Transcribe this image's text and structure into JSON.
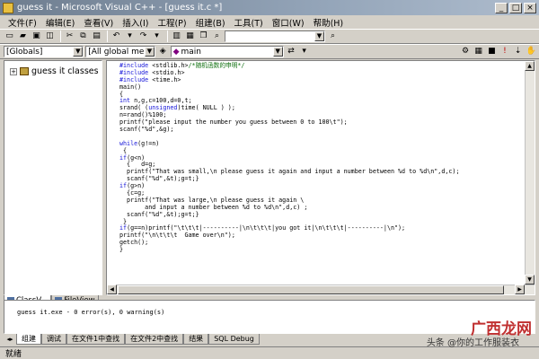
{
  "window": {
    "title": "guess it - Microsoft Visual C++ - [guess it.c *]"
  },
  "menubar": {
    "items": [
      "文件(F)",
      "编辑(E)",
      "查看(V)",
      "插入(I)",
      "工程(P)",
      "组建(B)",
      "工具(T)",
      "窗口(W)",
      "帮助(H)"
    ]
  },
  "toolbar2": {
    "scope_combo": "[Globals]",
    "members_combo": "[All global member",
    "function_combo": "main"
  },
  "workspace": {
    "tree_root": "guess it classes",
    "tabs": [
      "ClassV...",
      "FileView"
    ]
  },
  "editor": {
    "lines": [
      "#include <stdlib.h>/*随机函数的申明*/",
      "#include <stdio.h>",
      "#include <time.h>",
      "main()",
      "{",
      "int n,g,c=100,d=0,t;",
      "srand( (unsigned)time( NULL ) );",
      "n=rand()%100;",
      "printf(\"please input the number you guess between 0 to 100\\t\");",
      "scanf(\"%d\",&g);",
      "",
      "while(g!=n)",
      " {",
      "if(g<n)",
      "  {   d=g;",
      "  printf(\"That was small,\\n please guess it again and input a number between %d to %d\\n\",d,c);",
      "  scanf(\"%d\",&t);g=t;}",
      "if(g>n)",
      "  {c=g;",
      "  printf(\"That was large,\\n please guess it again \\",
      "       and input a number between %d to %d\\n\",d,c) ;",
      "  scanf(\"%d\",&t);g=t;}",
      " }",
      "if(g==n)printf(\"\\t\\t\\t|----------|\\n\\t\\t\\t|you got it|\\n\\t\\t\\t|----------|\\n\");",
      "printf(\"\\n\\t\\t\\t  Game over\\n\");",
      "getch();",
      "}"
    ]
  },
  "output": {
    "text": "guess it.exe - 0 error(s), 0 warning(s)",
    "tabs": [
      "组建",
      "调试",
      "在文件1中查找",
      "在文件2中查找",
      "结果",
      "SQL Debug"
    ]
  },
  "statusbar": {
    "text": "就绪"
  },
  "watermark": {
    "main": "广西龙网",
    "sub": "头条 @你的工作服装衣"
  }
}
